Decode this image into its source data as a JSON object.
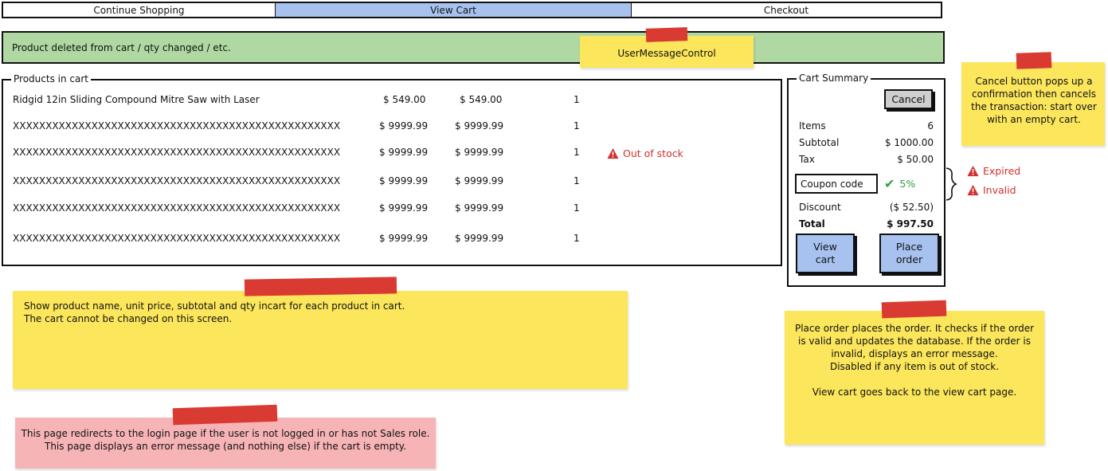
{
  "tabs": [
    {
      "label": "Continue Shopping",
      "active": false
    },
    {
      "label": "View Cart",
      "active": true
    },
    {
      "label": "Checkout",
      "active": false
    }
  ],
  "message_bar": {
    "text": "Product deleted from cart / qty changed / etc.",
    "note_label": "UserMessageControl"
  },
  "products": {
    "legend": "Products in cart",
    "rows": [
      {
        "name": "Ridgid 12in Sliding Compound  Mitre Saw with Laser",
        "unit": "$ 549.00",
        "subtotal": "$ 549.00",
        "qty": "1",
        "status": ""
      },
      {
        "name": "XXXXXXXXXXXXXXXXXXXXXXXXXXXXXXXXXXXXXXXXXXXXXXXXXX",
        "unit": "$ 9999.99",
        "subtotal": "$ 9999.99",
        "qty": "1",
        "status": ""
      },
      {
        "name": "XXXXXXXXXXXXXXXXXXXXXXXXXXXXXXXXXXXXXXXXXXXXXXXXXX",
        "unit": "$ 9999.99",
        "subtotal": "$ 9999.99",
        "qty": "1",
        "status": "Out of stock"
      },
      {
        "name": "XXXXXXXXXXXXXXXXXXXXXXXXXXXXXXXXXXXXXXXXXXXXXXXXXX",
        "unit": "$ 9999.99",
        "subtotal": "$ 9999.99",
        "qty": "1",
        "status": ""
      },
      {
        "name": "XXXXXXXXXXXXXXXXXXXXXXXXXXXXXXXXXXXXXXXXXXXXXXXXXX",
        "unit": "$ 9999.99",
        "subtotal": "$ 9999.99",
        "qty": "1",
        "status": ""
      },
      {
        "name": "XXXXXXXXXXXXXXXXXXXXXXXXXXXXXXXXXXXXXXXXXXXXXXXXXX",
        "unit": "$ 9999.99",
        "subtotal": "$ 9999.99",
        "qty": "1",
        "status": ""
      }
    ]
  },
  "summary": {
    "legend": "Cart Summary",
    "cancel_label": "Cancel",
    "items_label": "Items",
    "items_value": "6",
    "subtotal_label": "Subtotal",
    "subtotal_value": "$ 1000.00",
    "tax_label": "Tax",
    "tax_value": "$ 50.00",
    "coupon_label": "Coupon code",
    "coupon_value": "5%",
    "discount_label": "Discount",
    "discount_value": "($ 52.50)",
    "total_label": "Total",
    "total_value": "$ 997.50",
    "view_cart_label": "View cart",
    "place_order_label": "Place order"
  },
  "coupon_states": {
    "expired": "Expired",
    "invalid": "Invalid"
  },
  "notes": {
    "cancel": "Cancel button pops up a confirmation then cancels the transaction: start over with an empty cart.",
    "products_line1": "Show product name, unit price, subtotal and qty incart for each product in cart.",
    "products_line2": "The cart cannot be changed on this screen.",
    "place_order_line1": "Place order places the order. It checks if the order is valid and updates the database. If the order is invalid, displays an error message.",
    "place_order_line2": "Disabled if any item is out of stock.",
    "place_order_line3": "View cart goes back to the view cart page.",
    "redirect_line1": "This page redirects to the login page if the user is not logged in or has not Sales role.",
    "redirect_line2": "This page displays an error message (and nothing else) if the cart is empty."
  },
  "colors": {
    "active_tab": "#a7c2ef",
    "message_bg": "#b0d8a3",
    "note": "#fbe65c",
    "note_pink": "#f7b4b7",
    "tape": "#d93a31",
    "warning": "#d0312d",
    "ok": "#2ea043",
    "button": "#a7c2ef",
    "cancel_button": "#cfcfcf"
  }
}
